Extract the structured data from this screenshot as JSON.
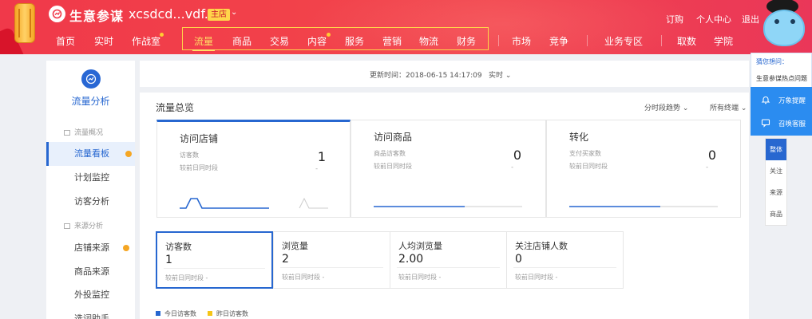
{
  "header": {
    "logo_text": "生意参谋",
    "shop_name": "xcsdcd...vdf...",
    "shop_badge": "主店",
    "top_links": [
      "订购",
      "个人中心",
      "退出"
    ],
    "nav": [
      {
        "label": "首页"
      },
      {
        "label": "实时"
      },
      {
        "label": "作战室"
      },
      {
        "label": "流量"
      },
      {
        "label": "商品"
      },
      {
        "label": "交易"
      },
      {
        "label": "内容"
      },
      {
        "label": "服务"
      },
      {
        "label": "营销"
      },
      {
        "label": "物流"
      },
      {
        "label": "财务"
      },
      {
        "label": "市场"
      },
      {
        "label": "竞争"
      },
      {
        "label": "业务专区"
      },
      {
        "label": "取数"
      },
      {
        "label": "学院"
      }
    ]
  },
  "sidebar": {
    "title": "流量分析",
    "group1": "流量概况",
    "group2": "来源分析",
    "items": [
      {
        "label": "流量看板"
      },
      {
        "label": "计划监控"
      },
      {
        "label": "访客分析"
      },
      {
        "label": "店铺来源"
      },
      {
        "label": "商品来源"
      },
      {
        "label": "外投监控"
      },
      {
        "label": "选词助手"
      }
    ]
  },
  "update_bar": {
    "update_time": "更新时间：2018-06-15 14:17:09",
    "realtime": "实时"
  },
  "main": {
    "title": "流量总览",
    "ctrl_trend": "分时段趋势",
    "ctrl_device": "所有终端",
    "cards": [
      {
        "title": "访问店铺",
        "k1": "访客数",
        "v": "1",
        "k2": "较前日同时段",
        "d": "-"
      },
      {
        "title": "访问商品",
        "k1": "商品访客数",
        "v": "0",
        "k2": "较前日同时段",
        "d": "-"
      },
      {
        "title": "转化",
        "k1": "支付买家数",
        "v": "0",
        "k2": "较前日同时段",
        "d": "-"
      }
    ],
    "metrics": [
      {
        "label": "访客数",
        "value": "1",
        "cmp": "较前日同时段  -"
      },
      {
        "label": "浏览量",
        "value": "2",
        "cmp": "较前日同时段  -"
      },
      {
        "label": "人均浏览量",
        "value": "2.00",
        "cmp": "较前日同时段  -"
      },
      {
        "label": "关注店铺人数",
        "value": "0",
        "cmp": "较前日同时段  -"
      }
    ],
    "legend_today": "今日访客数",
    "legend_yesterday": "昨日访客数"
  },
  "right_panel": {
    "guess": "猜您想问：",
    "hot": "生意参谋热点问题",
    "btn1": "万象提醒",
    "btn2": "召唤客服",
    "tabs": [
      "整体",
      "关注",
      "来源",
      "商品"
    ]
  },
  "colors": {
    "brand_blue": "#2767d0",
    "header_red": "#f0394a",
    "accent_yellow": "#ffd54a",
    "dot_orange": "#f5a623"
  }
}
